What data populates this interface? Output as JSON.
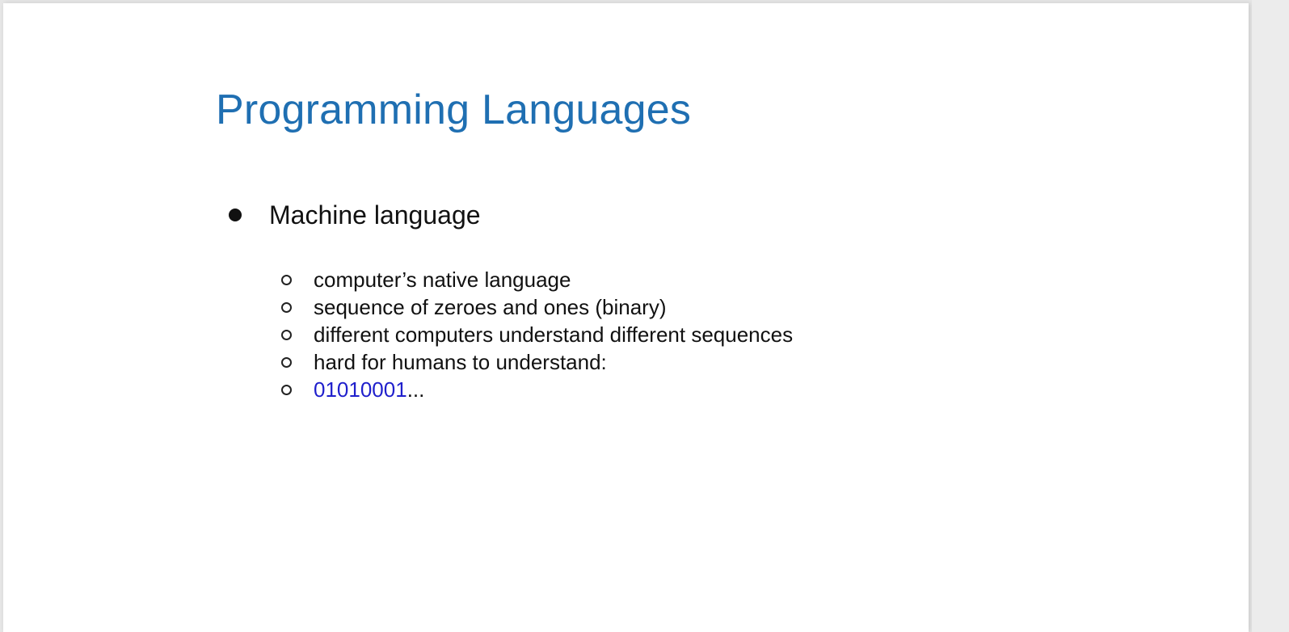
{
  "slide": {
    "title": "Programming Languages",
    "main_bullet": "Machine language",
    "sub_bullets": [
      "computer’s native language",
      "sequence of zeroes and ones (binary)",
      "different computers understand different sequences",
      "hard for humans to understand:"
    ],
    "binary_example": {
      "code": "01010001",
      "ellipsis": "..."
    }
  },
  "colors": {
    "title": "#1f6fb2",
    "binary": "#1f1fcc",
    "text": "#111111",
    "background": "#ffffff"
  }
}
